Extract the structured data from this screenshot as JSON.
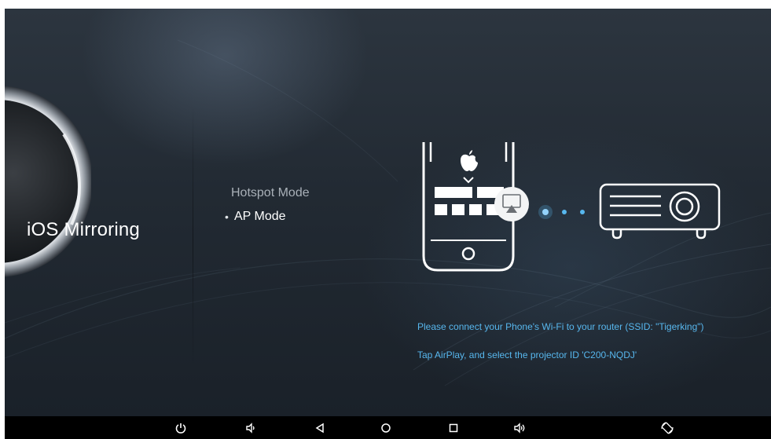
{
  "app": {
    "title": "iOS Mirroring"
  },
  "modes": [
    {
      "label": "Hotspot Mode",
      "selected": false
    },
    {
      "label": "AP Mode",
      "selected": true
    }
  ],
  "illustration": {
    "phone_icon": "apple-logo-icon",
    "airplay_icon": "airplay-icon",
    "target_icon": "projector-icon"
  },
  "instructions": {
    "line1": "Please connect your Phone's Wi-Fi to your router (SSID: \"Tigerking\")",
    "line2": "Tap AirPlay, and select the projector ID 'C200-NQDJ'"
  },
  "navbar": {
    "buttons": [
      "power-icon",
      "volume-down-icon",
      "back-icon",
      "home-icon",
      "recents-icon",
      "volume-up-icon",
      "rotate-icon"
    ]
  },
  "colors": {
    "accent": "#57b7ee",
    "background": "#222a33",
    "navbar": "#000000"
  }
}
